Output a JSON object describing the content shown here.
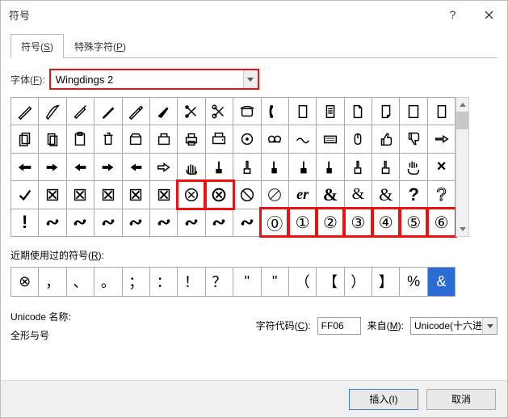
{
  "titlebar": {
    "title": "符号"
  },
  "tabs": {
    "symbols": "符号(S)",
    "special": "特殊字符(P)"
  },
  "font": {
    "label": "字体(F):",
    "value": "Wingdings 2"
  },
  "grid": {
    "rows": [
      [
        "pen-diag",
        "pen-quill",
        "pen-nib",
        "pencil-diag",
        "pencil",
        "brush",
        "scissors-solid",
        "scissors-outline",
        "phone-old",
        "phone-handset",
        "doc",
        "doc-lines",
        "doc-corner",
        "doc-folded",
        "doc-blank",
        "doc"
      ],
      [
        "docs-stack",
        "docs-two",
        "clipboard",
        "trash",
        "filebox",
        "filebox-alt",
        "printer",
        "fax",
        "circle-dot",
        "tape",
        "wave",
        "keyboard",
        "mouse",
        "thumb-up",
        "thumb-down",
        "point-right"
      ],
      [
        "point-left-solid",
        "point-right-solid-sm",
        "point-left-sm",
        "point-right-sm",
        "point-left-solid-sm",
        "point-right-outline",
        "hand-open",
        "finger-up-solid",
        "finger-up",
        "finger-up-2",
        "finger-up-3",
        "finger-up-left",
        "finger-up-outline",
        "finger-up-outline-2",
        "hand-spread",
        "x-mark"
      ],
      [
        "check",
        "x-box",
        "x-box-2",
        "x-box-3",
        "x-box-4",
        "x-box-5",
        "x-circle",
        "x-circle-bold",
        "no-sign",
        "no-sign-outline",
        "er",
        "amp-bold",
        "amp-script",
        "amp-fancy",
        "question-bold",
        "question-outline"
      ],
      [
        "exclaim-bold",
        "swirl-1",
        "swirl-2",
        "swirl-3",
        "swirl-4",
        "swirl-5",
        "swirl-6",
        "swirl-7",
        "swirl-8",
        "circ-0",
        "circ-1",
        "circ-2",
        "circ-3",
        "circ-4",
        "circ-5",
        "circ-6"
      ]
    ]
  },
  "recent": {
    "label": "近期使用过的符号(R):",
    "items": [
      "⊗",
      "，",
      "、",
      "。",
      "；",
      "：",
      "！",
      "？",
      "\"",
      "\"",
      "（",
      "【",
      "）",
      "】",
      "%",
      "&"
    ]
  },
  "unicode": {
    "name_label": "Unicode 名称:",
    "name_value": "全形与号",
    "code_label": "字符代码(C):",
    "code_value": "FF06",
    "from_label": "来自(M):",
    "from_value": "Unicode(十六进制"
  },
  "buttons": {
    "insert": "插入(I)",
    "cancel": "取消"
  },
  "chart_data": null
}
